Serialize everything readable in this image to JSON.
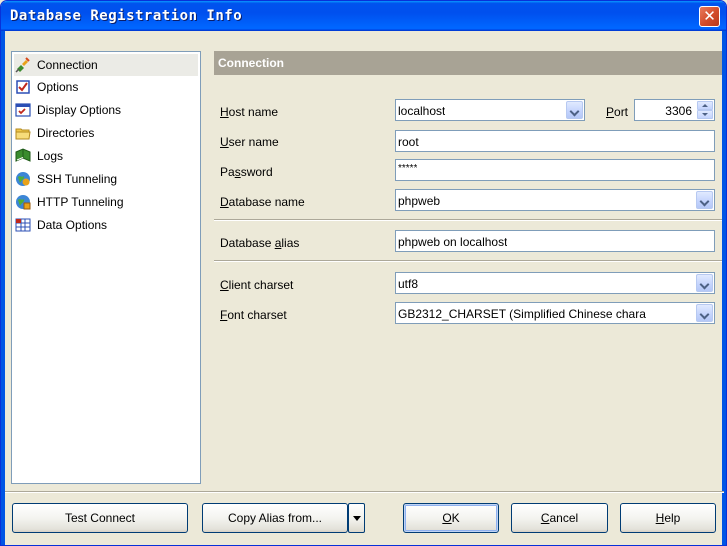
{
  "window": {
    "title": "Database Registration Info",
    "close_glyph": "✕"
  },
  "nav": {
    "items": [
      {
        "label": "Connection",
        "icon": "plug-icon",
        "selected": true
      },
      {
        "label": "Options",
        "icon": "checkbox-icon"
      },
      {
        "label": "Display Options",
        "icon": "display-options-icon"
      },
      {
        "label": "Directories",
        "icon": "folder-icon"
      },
      {
        "label": "Logs",
        "icon": "book-icon"
      },
      {
        "label": "SSH Tunneling",
        "icon": "ssh-globe-icon"
      },
      {
        "label": "HTTP Tunneling",
        "icon": "http-globe-icon"
      },
      {
        "label": "Data Options",
        "icon": "grid-table-icon"
      }
    ]
  },
  "panel": {
    "title": "Connection",
    "host": {
      "label_pre": "",
      "label_key": "H",
      "label_post": "ost name",
      "value": "localhost"
    },
    "port": {
      "label_key": "P",
      "label_post": "ort",
      "value": "3306"
    },
    "user": {
      "label_key": "U",
      "label_post": "ser name",
      "value": "root"
    },
    "password": {
      "label_pre": "Pa",
      "label_key": "s",
      "label_post": "sword",
      "value": "*****"
    },
    "database": {
      "label_key": "D",
      "label_post": "atabase name",
      "value": "phpweb"
    },
    "alias": {
      "label_pre": "Database ",
      "label_key": "a",
      "label_post": "lias",
      "value": "phpweb on localhost"
    },
    "client_charset": {
      "label_key": "C",
      "label_post": "lient charset",
      "value": "utf8"
    },
    "font_charset": {
      "label_key": "F",
      "label_post": "ont charset",
      "value": "GB2312_CHARSET (Simplified Chinese chara"
    }
  },
  "buttons": {
    "test_connect": "Test Connect",
    "copy_alias": "Copy Alias from...",
    "ok_key": "O",
    "ok_post": "K",
    "cancel_key": "C",
    "cancel_post": "ancel",
    "help_key": "H",
    "help_post": "elp"
  },
  "colors": {
    "title_bar": "#0054e3",
    "panel_header": "#a8a395",
    "dialog_bg": "#ece9d8"
  }
}
